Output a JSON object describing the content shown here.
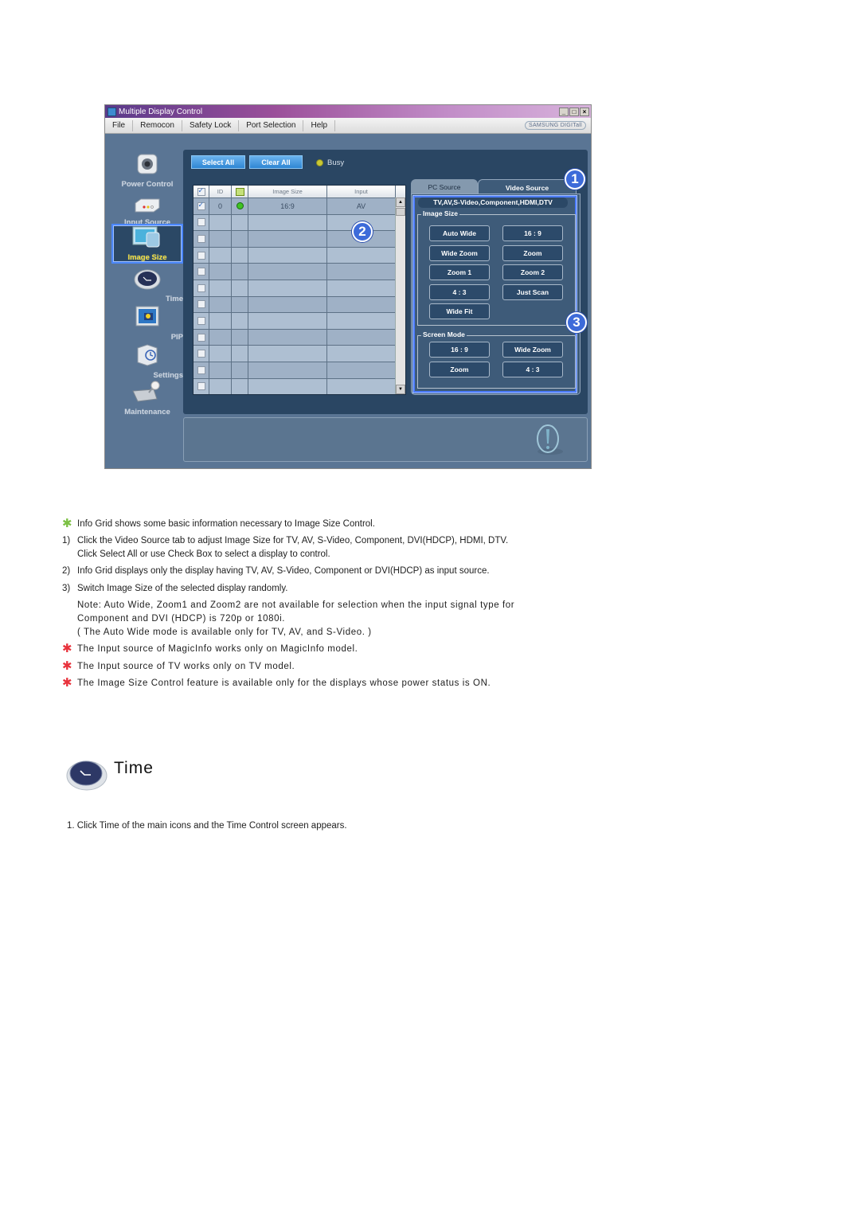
{
  "window": {
    "title": "Multiple Display Control",
    "controls": [
      "minimize",
      "maximize",
      "close"
    ],
    "menu": [
      "File",
      "Remocon",
      "Safety Lock",
      "Port Selection",
      "Help"
    ],
    "brand": "SAMSUNG DIGITall"
  },
  "sidebar": {
    "items": [
      {
        "label": "Power Control",
        "icon": "power-control-icon",
        "active": false
      },
      {
        "label": "Input Source",
        "icon": "input-source-icon",
        "active": false
      },
      {
        "label": "Image Size",
        "icon": "image-size-icon",
        "active": true
      },
      {
        "label": "Time",
        "icon": "clock-icon",
        "active": false
      },
      {
        "label": "PIP",
        "icon": "pip-icon",
        "active": false
      },
      {
        "label": "Settings",
        "icon": "settings-icon",
        "active": false
      },
      {
        "label": "Maintenance",
        "icon": "maintenance-icon",
        "active": false
      }
    ]
  },
  "toolbar": {
    "select_all": "Select All",
    "clear_all": "Clear All",
    "busy_label": "Busy"
  },
  "grid": {
    "columns": [
      "",
      "ID",
      "",
      "Image Size",
      "Input"
    ],
    "rows": [
      {
        "checked": true,
        "id": "0",
        "status": "on",
        "image_size": "16:9",
        "input": "AV"
      },
      {
        "checked": false,
        "id": "",
        "status": "",
        "image_size": "",
        "input": ""
      },
      {
        "checked": false,
        "id": "",
        "status": "",
        "image_size": "",
        "input": ""
      },
      {
        "checked": false,
        "id": "",
        "status": "",
        "image_size": "",
        "input": ""
      },
      {
        "checked": false,
        "id": "",
        "status": "",
        "image_size": "",
        "input": ""
      },
      {
        "checked": false,
        "id": "",
        "status": "",
        "image_size": "",
        "input": ""
      },
      {
        "checked": false,
        "id": "",
        "status": "",
        "image_size": "",
        "input": ""
      },
      {
        "checked": false,
        "id": "",
        "status": "",
        "image_size": "",
        "input": ""
      },
      {
        "checked": false,
        "id": "",
        "status": "",
        "image_size": "",
        "input": ""
      },
      {
        "checked": false,
        "id": "",
        "status": "",
        "image_size": "",
        "input": ""
      },
      {
        "checked": false,
        "id": "",
        "status": "",
        "image_size": "",
        "input": ""
      },
      {
        "checked": false,
        "id": "",
        "status": "",
        "image_size": "",
        "input": ""
      }
    ]
  },
  "callouts": [
    "1",
    "2",
    "3"
  ],
  "tabs": {
    "pc_source": "PC Source",
    "video_source": "Video Source",
    "active": "Video Source",
    "source_types": "TV,AV,S-Video,Component,HDMI,DTV"
  },
  "image_size": {
    "legend": "Image Size",
    "buttons": [
      "Auto Wide",
      "16 : 9",
      "Wide Zoom",
      "Zoom",
      "Zoom 1",
      "Zoom 2",
      "4 : 3",
      "Just Scan",
      "Wide Fit"
    ]
  },
  "screen_mode": {
    "legend": "Screen Mode",
    "buttons": [
      "16 : 9",
      "Wide Zoom",
      "Zoom",
      "4 : 3"
    ]
  },
  "doc": {
    "intro": "Info Grid shows some basic information necessary to Image Size Control.",
    "steps": [
      {
        "num": "1)",
        "lines": [
          "Click the Video Source tab to adjust Image Size for TV, AV, S-Video, Component, DVI(HDCP), HDMI, DTV.",
          "Click Select All or use Check Box to select a display to control."
        ]
      },
      {
        "num": "2)",
        "lines": [
          "Info Grid displays only the display having TV, AV, S-Video, Component or DVI(HDCP) as input source."
        ]
      },
      {
        "num": "3)",
        "lines": [
          "Switch Image Size of the selected display randomly."
        ]
      }
    ],
    "note": [
      "Note: Auto Wide, Zoom1 and Zoom2 are not available for selection when the input signal type for",
      "Component and DVI (HDCP) is 720p or 1080i.",
      "( The Auto Wide mode is available only for TV, AV, and S-Video. )"
    ],
    "warnings": [
      "The Input source of MagicInfo works only on MagicInfo model.",
      "The Input source of TV works only on TV model.",
      "The Image Size Control feature is available only for the displays whose power status is ON."
    ],
    "colors": {
      "green_star": "#7bc043",
      "red_star": "#e8323c"
    }
  },
  "section": {
    "title": "Time",
    "step": "1.  Click Time of the main icons and the Time Control screen appears."
  }
}
